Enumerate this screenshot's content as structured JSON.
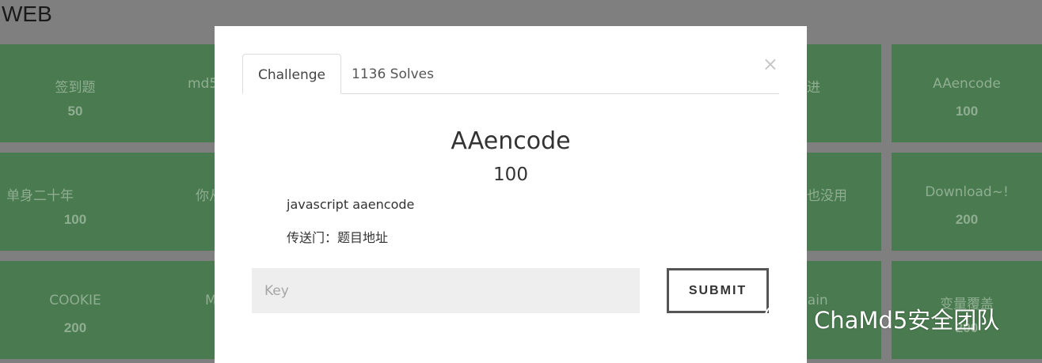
{
  "category": {
    "title": "WEB"
  },
  "tiles": [
    {
      "name": "签到题",
      "points": "50"
    },
    {
      "name": "md5",
      "points": ""
    },
    {
      "name": "",
      "points": ""
    },
    {
      "name": "",
      "points": ""
    },
    {
      "name": "",
      "points": ""
    },
    {
      "name": "进",
      "points": ""
    },
    {
      "name": "AAencode",
      "points": "100"
    },
    {
      "name": "单身二十年",
      "points": "100"
    },
    {
      "name": "你从",
      "points": ""
    },
    {
      "name": "",
      "points": ""
    },
    {
      "name": "",
      "points": ""
    },
    {
      "name": "",
      "points": ""
    },
    {
      "name": "也没用",
      "points": ""
    },
    {
      "name": "Download~!",
      "points": "200"
    },
    {
      "name": "COOKIE",
      "points": "200"
    },
    {
      "name": "M",
      "points": ""
    },
    {
      "name": "",
      "points": ""
    },
    {
      "name": "",
      "points": ""
    },
    {
      "name": "",
      "points": ""
    },
    {
      "name": "gain",
      "points": ""
    },
    {
      "name": "变量覆盖",
      "points": "200"
    }
  ],
  "modal": {
    "tabs": [
      {
        "label": "Challenge",
        "active": true
      },
      {
        "label": "1136 Solves",
        "active": false
      }
    ],
    "close_label": "×",
    "challenge_name": "AAencode",
    "challenge_value": "100",
    "description": "javascript aaencode",
    "link_prefix": "传送门：",
    "link_text": "题目地址",
    "key_placeholder": "Key",
    "key_value": "",
    "submit_label": "SUBMIT"
  },
  "watermark": {
    "text": "ChaMd5安全团队",
    "icon": "wechat-icon"
  },
  "colors": {
    "backdrop": "#7f7f7f",
    "tile": "#4a7a4f",
    "modal": "#ffffff",
    "input_bg": "#eeeeee"
  }
}
